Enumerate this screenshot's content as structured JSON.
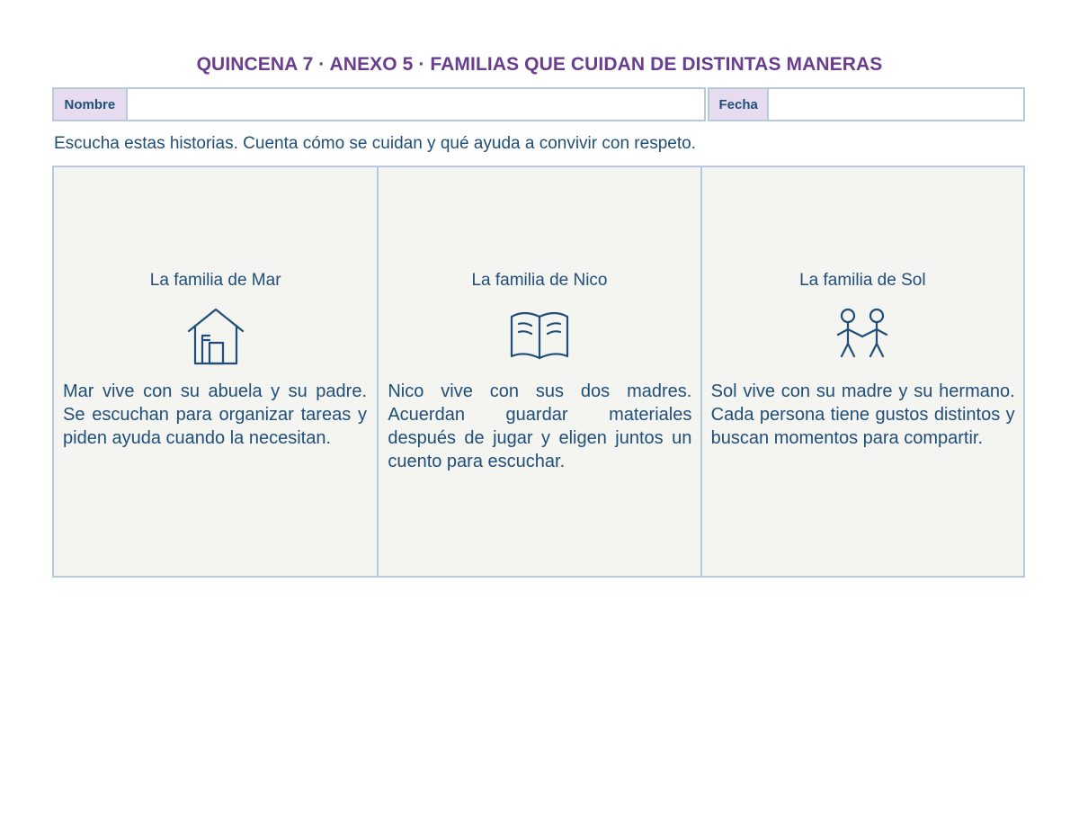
{
  "header": {
    "title": "QUINCENA 7 · ANEXO 5 · FAMILIAS QUE CUIDAN DE DISTINTAS MANERAS"
  },
  "form": {
    "name_label": "Nombre",
    "name_value": "",
    "date_label": "Fecha",
    "date_value": ""
  },
  "instructions": "Escucha estas historias. Cuenta cómo se cuidan y qué ayuda a convivir con respeto.",
  "colors": {
    "title": "#6a3d8f",
    "text": "#1f4e79",
    "label_bg": "#e7dcef",
    "border": "#b8c9de",
    "card_bg": "#f4f4f1"
  },
  "cards": [
    {
      "title": "La familia de Mar",
      "icon": "house-icon",
      "text": "Mar vive con su abuela y su padre. Se escuchan para organizar tareas y piden ayuda cuando la necesitan."
    },
    {
      "title": "La familia de Nico",
      "icon": "open-book-icon",
      "text": "Nico vive con sus dos madres. Acuerdan guardar materiales después de jugar y eligen juntos un cuento para escuchar."
    },
    {
      "title": "La familia de Sol",
      "icon": "two-people-icon",
      "text": "Sol vive con su madre y su hermano. Cada persona tiene gustos distintos y buscan momentos para compartir."
    }
  ]
}
